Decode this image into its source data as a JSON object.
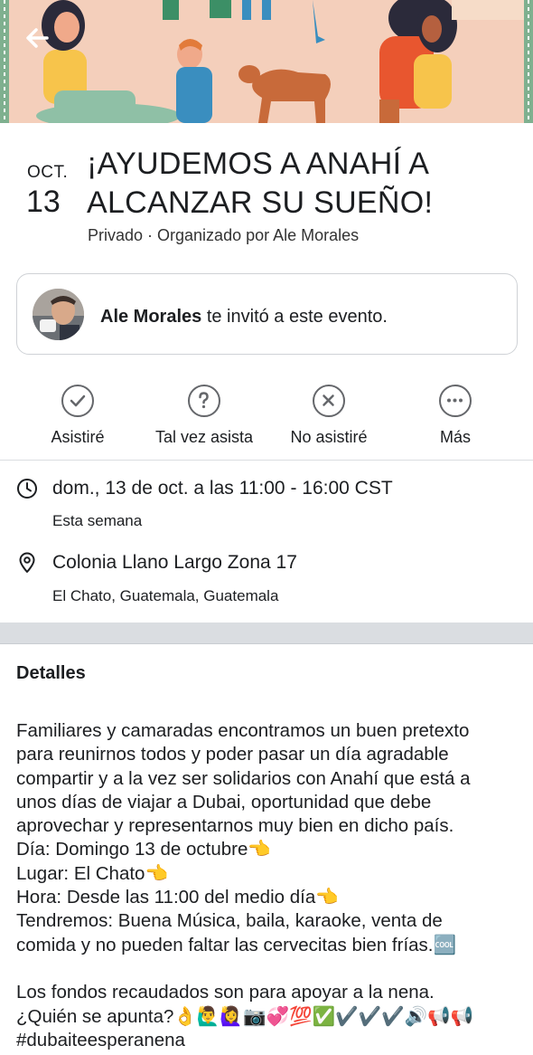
{
  "event": {
    "month": "OCT.",
    "day": "13",
    "title_line1": "¡AYUDEMOS A ANAHÍ A",
    "title_line2": "ALCANZAR SU SUEÑO!",
    "subtitle": "Privado · Organizado por Ale Morales"
  },
  "invite": {
    "name": "Ale Morales",
    "text": " te invitó a este evento."
  },
  "actions": [
    {
      "label": "Asistiré",
      "icon": "check-circle-icon"
    },
    {
      "label": "Tal vez asista",
      "icon": "question-circle-icon"
    },
    {
      "label": "No asistiré",
      "icon": "x-circle-icon"
    },
    {
      "label": "Más",
      "icon": "more-icon"
    }
  ],
  "time": {
    "main": "dom., 13 de oct. a las 11:00 - 16:00 CST",
    "secondary": "Esta semana",
    "icon": "clock-icon"
  },
  "location": {
    "main": "Colonia Llano Largo Zona 17",
    "secondary": "El Chato, Guatemala, Guatemala",
    "icon": "location-pin-icon"
  },
  "details": {
    "heading": "Detalles",
    "lines": [
      "Familiares y camaradas encontramos un buen pretexto",
      "para reunirnos todos y poder pasar un día agradable",
      "compartir y a la vez ser solidarios con Anahí que está a",
      "unos días de viajar a Dubai, oportunidad que debe",
      "aprovechar y representarnos muy bien en dicho país.",
      "Día: Domingo 13 de octubre👈",
      "Lugar: El Chato👈",
      "Hora: Desde las 11:00 del medio día👈",
      "Tendremos: Buena Música, baila, karaoke, venta de",
      "comida y no pueden faltar las cervecitas bien frías.🆒",
      "",
      "Los fondos recaudados son para apoyar a la nena.",
      "¿Quién se apunta?👌🙋‍♂️🙋‍♀️📷💞💯✅✔️✔️✔️🔊📢📢",
      "#dubaiteesperanena"
    ]
  },
  "colors": {
    "text": "#1c1e21",
    "icon_gray": "#65676b",
    "divider": "#dadde1"
  }
}
